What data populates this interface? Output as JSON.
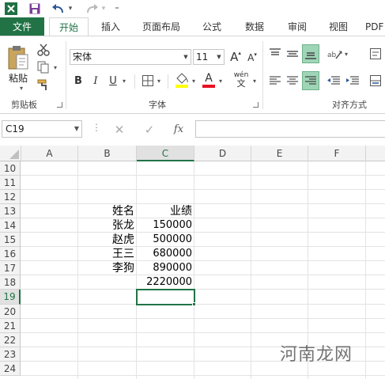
{
  "quick_access": {
    "undo_arrow": "▾",
    "customize": "⁼"
  },
  "tabs": [
    {
      "label": "文件"
    },
    {
      "label": "开始"
    },
    {
      "label": "插入"
    },
    {
      "label": "页面布局"
    },
    {
      "label": "公式"
    },
    {
      "label": "数据"
    },
    {
      "label": "审阅"
    },
    {
      "label": "视图"
    },
    {
      "label": "PDF"
    }
  ],
  "ribbon": {
    "clipboard": {
      "paste_label": "粘贴",
      "group_label": "剪贴板"
    },
    "font": {
      "font_name": "宋体",
      "font_size": "11",
      "bold": "B",
      "italic": "I",
      "underline": "U",
      "grow": "A",
      "shrink": "A",
      "font_color_letter": "A",
      "phonetic": "wén",
      "group_label": "字体"
    },
    "alignment": {
      "group_label": "对齐方式"
    }
  },
  "formula_bar": {
    "name_box": "C19",
    "fx": "fx",
    "value": ""
  },
  "columns": [
    "A",
    "B",
    "C",
    "D",
    "E",
    "F"
  ],
  "rows": [
    "10",
    "11",
    "12",
    "13",
    "14",
    "15",
    "16",
    "17",
    "18",
    "19",
    "20",
    "21",
    "22",
    "23",
    "24"
  ],
  "selected_cell": {
    "column": "C",
    "row": "19"
  },
  "cells": [
    {
      "ref": "B13",
      "value": "姓名"
    },
    {
      "ref": "C13",
      "value": "业绩"
    },
    {
      "ref": "B14",
      "value": "张龙"
    },
    {
      "ref": "C14",
      "value": "150000"
    },
    {
      "ref": "B15",
      "value": "赵虎"
    },
    {
      "ref": "C15",
      "value": "500000"
    },
    {
      "ref": "B16",
      "value": "王三"
    },
    {
      "ref": "C16",
      "value": "680000"
    },
    {
      "ref": "B17",
      "value": "李狗"
    },
    {
      "ref": "C17",
      "value": "890000"
    },
    {
      "ref": "C18",
      "value": "2220000"
    }
  ],
  "watermark": "河南龙网",
  "colors": {
    "accent": "#217346",
    "font_color_bar": "#e81123",
    "highlight_bar": "#ffff00"
  }
}
